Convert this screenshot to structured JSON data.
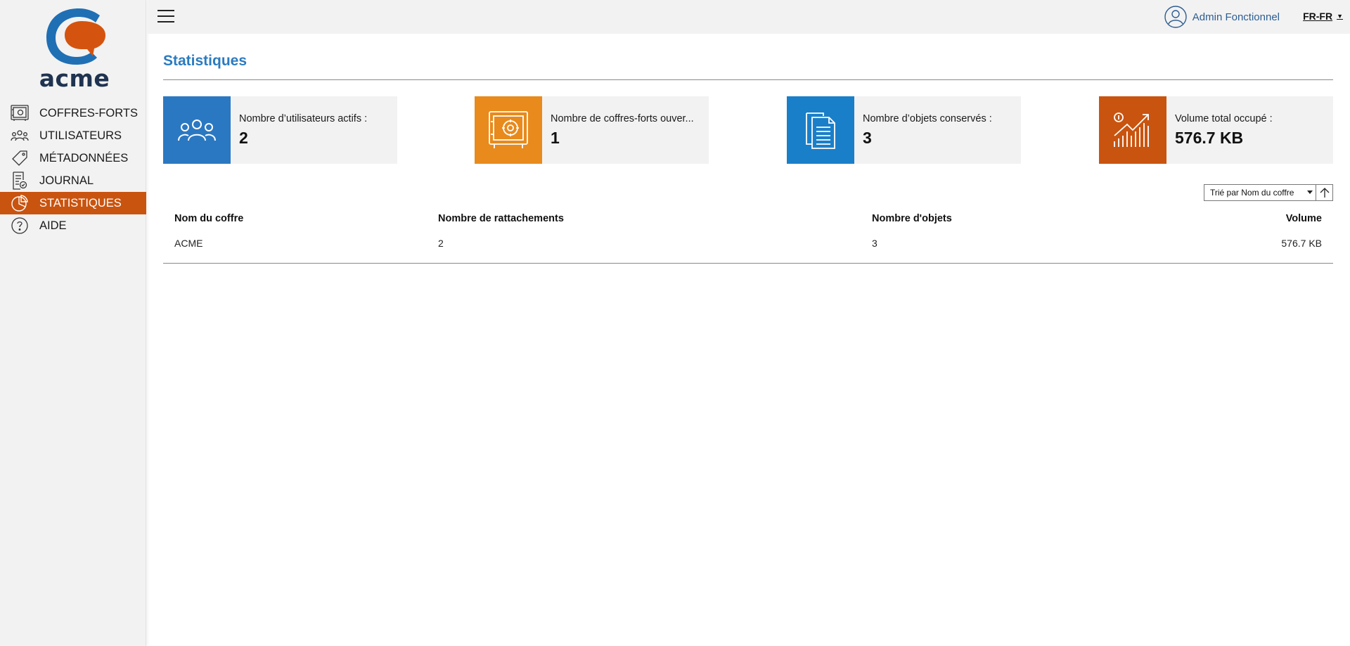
{
  "brand": {
    "logo_text": "acme"
  },
  "sidebar": {
    "items": [
      {
        "label": "COFFRES-FORTS",
        "icon": "safe-icon"
      },
      {
        "label": "UTILISATEURS",
        "icon": "users-icon"
      },
      {
        "label": "MÉTADONNÉES",
        "icon": "tag-icon"
      },
      {
        "label": "JOURNAL",
        "icon": "journal-icon"
      },
      {
        "label": "STATISTIQUES",
        "icon": "pie-chart-icon",
        "active": true
      },
      {
        "label": "AIDE",
        "icon": "help-icon"
      }
    ]
  },
  "header": {
    "user_name": "Admin Fonctionnel",
    "language": "FR-FR"
  },
  "page": {
    "title": "Statistiques"
  },
  "cards": [
    {
      "label": "Nombre d’utilisateurs actifs :",
      "value": "2",
      "color": "#2b78c2",
      "icon": "users-icon"
    },
    {
      "label": "Nombre de coffres-forts ouver...",
      "value": "1",
      "color": "#e88a1c",
      "icon": "safe-icon"
    },
    {
      "label": "Nombre d’objets conservés :",
      "value": "3",
      "color": "#1a7fc9",
      "icon": "documents-icon"
    },
    {
      "label": "Volume total occupé :",
      "value": "576.7 KB",
      "color": "#c9540f",
      "icon": "growth-chart-icon"
    }
  ],
  "sort": {
    "selected": "Trié par Nom du coffre",
    "direction_icon": "arrow-up-icon"
  },
  "table": {
    "headers": [
      "Nom du coffre",
      "Nombre de rattachements",
      "Nombre d'objets",
      "Volume"
    ],
    "rows": [
      [
        "ACME",
        "2",
        "3",
        "576.7 KB"
      ]
    ]
  }
}
